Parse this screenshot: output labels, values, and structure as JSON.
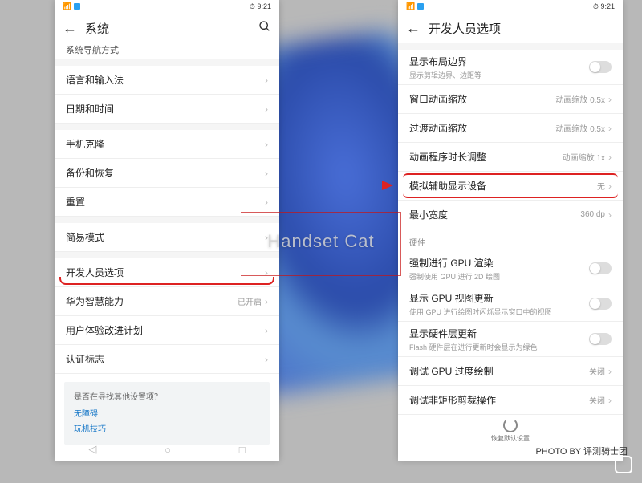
{
  "status": {
    "time": "9:21",
    "clock_icon": "⏱"
  },
  "left": {
    "title": "系统",
    "partial_top": "系统导航方式",
    "items": [
      {
        "label": "语言和输入法"
      },
      {
        "label": "日期和时间"
      }
    ],
    "items2": [
      {
        "label": "手机克隆"
      },
      {
        "label": "备份和恢复"
      },
      {
        "label": "重置"
      }
    ],
    "items3": [
      {
        "label": "简易模式"
      }
    ],
    "items4": [
      {
        "label": "开发人员选项",
        "hl": true
      },
      {
        "label": "华为智慧能力",
        "val": "已开启"
      },
      {
        "label": "用户体验改进计划"
      },
      {
        "label": "认证标志"
      }
    ],
    "tips": {
      "q": "是否在寻找其他设置项？",
      "links": [
        "无障碍",
        "玩机技巧"
      ]
    }
  },
  "right": {
    "title": "开发人员选项",
    "items": [
      {
        "label": "显示布局边界",
        "sub": "显示剪辑边界、边距等",
        "toggle": true
      },
      {
        "label": "窗口动画缩放",
        "val": "动画缩放 0.5x"
      },
      {
        "label": "过渡动画缩放",
        "val": "动画缩放 0.5x"
      },
      {
        "label": "动画程序时长调整",
        "val": "动画缩放 1x"
      },
      {
        "label": "模拟辅助显示设备",
        "val": "无",
        "hl": true
      },
      {
        "label": "最小宽度",
        "val": "360 dp"
      }
    ],
    "section": "硬件",
    "items2": [
      {
        "label": "强制进行 GPU 渲染",
        "sub": "强制使用 GPU 进行 2D 绘图",
        "toggle": true
      },
      {
        "label": "显示 GPU 视图更新",
        "sub": "使用 GPU 进行绘图时闪烁显示窗口中的视图",
        "toggle": true
      },
      {
        "label": "显示硬件层更新",
        "sub": "Flash 硬件层在进行更新时会显示为绿色",
        "toggle": true
      },
      {
        "label": "调试 GPU 过度绘制",
        "val": "关闭"
      },
      {
        "label": "调试非矩形剪裁操作",
        "val": "关闭"
      }
    ],
    "spinner": "恢复默认设置"
  },
  "watermark": {
    "center": "Handset Cat",
    "credit": "PHOTO BY   评测骑士团"
  }
}
